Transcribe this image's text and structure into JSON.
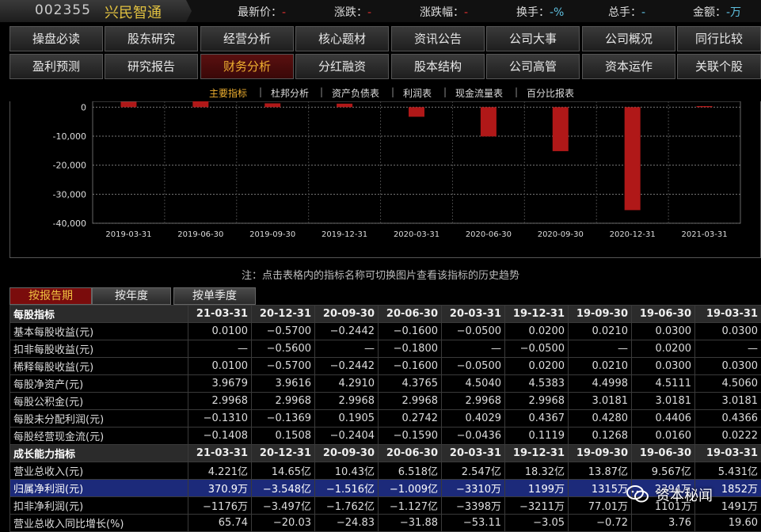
{
  "header": {
    "stock_code": "002355",
    "stock_name": "兴民智通",
    "quotes": [
      {
        "label": "最新价：",
        "value": "-"
      },
      {
        "label": "涨跌：",
        "value": "-"
      },
      {
        "label": "涨跌幅：",
        "value": "-"
      },
      {
        "label": "换手：",
        "value": "-%"
      },
      {
        "label": "总手：",
        "value": "-"
      },
      {
        "label": "金额：",
        "value": "-万"
      }
    ]
  },
  "nav": {
    "row1": [
      "操盘必读",
      "股东研究",
      "经营分析",
      "核心题材",
      "资讯公告",
      "公司大事",
      "公司概况",
      "同行比较"
    ],
    "row2": [
      "盈利预测",
      "研究报告",
      "财务分析",
      "分红融资",
      "股本结构",
      "公司高管",
      "资本运作",
      "关联个股"
    ],
    "active": "财务分析"
  },
  "subtabs": {
    "items": [
      "主要指标",
      "杜邦分析",
      "资产负债表",
      "利润表",
      "现金流量表",
      "百分比报表"
    ],
    "active": "主要指标"
  },
  "chart_data": {
    "type": "bar",
    "categories": [
      "2019-03-31",
      "2019-06-30",
      "2019-09-30",
      "2019-12-31",
      "2020-03-31",
      "2020-06-30",
      "2020-09-30",
      "2020-12-31",
      "2021-03-31"
    ],
    "values": [
      1852,
      2394,
      1315,
      1199,
      -3310,
      -10090,
      -15160,
      -35480,
      370.9
    ],
    "ylim": [
      -40000,
      2000
    ],
    "yticks": [
      0,
      -10000,
      -20000,
      -30000,
      -40000
    ],
    "ytick_labels": [
      "0",
      "-10,000",
      "-20,000",
      "-30,000",
      "-40,000"
    ],
    "grid": true,
    "bar_color": "#b01818"
  },
  "note": "注：点击表格内的指标名称可切换图片查看该指标的历史趋势",
  "period_tabs": {
    "items": [
      "按报告期",
      "按年度",
      "按单季度"
    ],
    "active": "按报告期"
  },
  "table": {
    "sections": [
      {
        "title": "每股指标",
        "dates": [
          "21-03-31",
          "20-12-31",
          "20-09-30",
          "20-06-30",
          "20-03-31",
          "19-12-31",
          "19-09-30",
          "19-06-30",
          "19-03-31"
        ],
        "rows": [
          {
            "label": "基本每股收益(元)",
            "values": [
              "0.0100",
              "−0.5700",
              "−0.2442",
              "−0.1600",
              "−0.0500",
              "0.0200",
              "0.0210",
              "0.0300",
              "0.0300"
            ]
          },
          {
            "label": "扣非每股收益(元)",
            "values": [
              "—",
              "−0.5600",
              "—",
              "−0.1800",
              "—",
              "−0.0500",
              "—",
              "0.0200",
              "—"
            ]
          },
          {
            "label": "稀释每股收益(元)",
            "values": [
              "0.0100",
              "−0.5700",
              "−0.2442",
              "−0.1600",
              "−0.0500",
              "0.0200",
              "0.0210",
              "0.0300",
              "0.0300"
            ]
          },
          {
            "label": "每股净资产(元)",
            "values": [
              "3.9679",
              "3.9616",
              "4.2910",
              "4.3765",
              "4.5040",
              "4.5383",
              "4.4998",
              "4.5111",
              "4.5060"
            ]
          },
          {
            "label": "每股公积金(元)",
            "values": [
              "2.9968",
              "2.9968",
              "2.9968",
              "2.9968",
              "2.9968",
              "2.9968",
              "3.0181",
              "3.0181",
              "3.0181"
            ]
          },
          {
            "label": "每股未分配利润(元)",
            "values": [
              "−0.1310",
              "−0.1369",
              "0.1905",
              "0.2742",
              "0.4029",
              "0.4367",
              "0.4280",
              "0.4406",
              "0.4366"
            ]
          },
          {
            "label": "每股经营现金流(元)",
            "values": [
              "−0.1408",
              "0.1508",
              "−0.2404",
              "−0.1590",
              "−0.0436",
              "0.1119",
              "0.1268",
              "0.0160",
              "0.0222"
            ]
          }
        ]
      },
      {
        "title": "成长能力指标",
        "dates": [
          "21-03-31",
          "20-12-31",
          "20-09-30",
          "20-06-30",
          "20-03-31",
          "19-12-31",
          "19-09-30",
          "19-06-30",
          "19-03-31"
        ],
        "rows": [
          {
            "label": "营业总收入(元)",
            "values": [
              "4.221亿",
              "14.65亿",
              "10.43亿",
              "6.518亿",
              "2.547亿",
              "18.32亿",
              "13.87亿",
              "9.567亿",
              "5.431亿"
            ]
          },
          {
            "label": "归属净利润(元)",
            "values": [
              "370.9万",
              "−3.548亿",
              "−1.516亿",
              "−1.009亿",
              "−3310万",
              "1199万",
              "1315万",
              "2394万",
              "1852万"
            ],
            "selected": true
          },
          {
            "label": "扣非净利润(元)",
            "values": [
              "−1176万",
              "−3.497亿",
              "−1.762亿",
              "−1.127亿",
              "−3398万",
              "−3211万",
              "77.01万",
              "1101万",
              "1491万"
            ]
          },
          {
            "label": "营业总收入同比增长(%)",
            "values": [
              "65.74",
              "−20.03",
              "−24.83",
              "−31.88",
              "−53.11",
              "−3.05",
              "−0.72",
              "3.76",
              "19.60"
            ]
          }
        ]
      }
    ]
  },
  "watermark": {
    "text": "资本秘闻"
  }
}
